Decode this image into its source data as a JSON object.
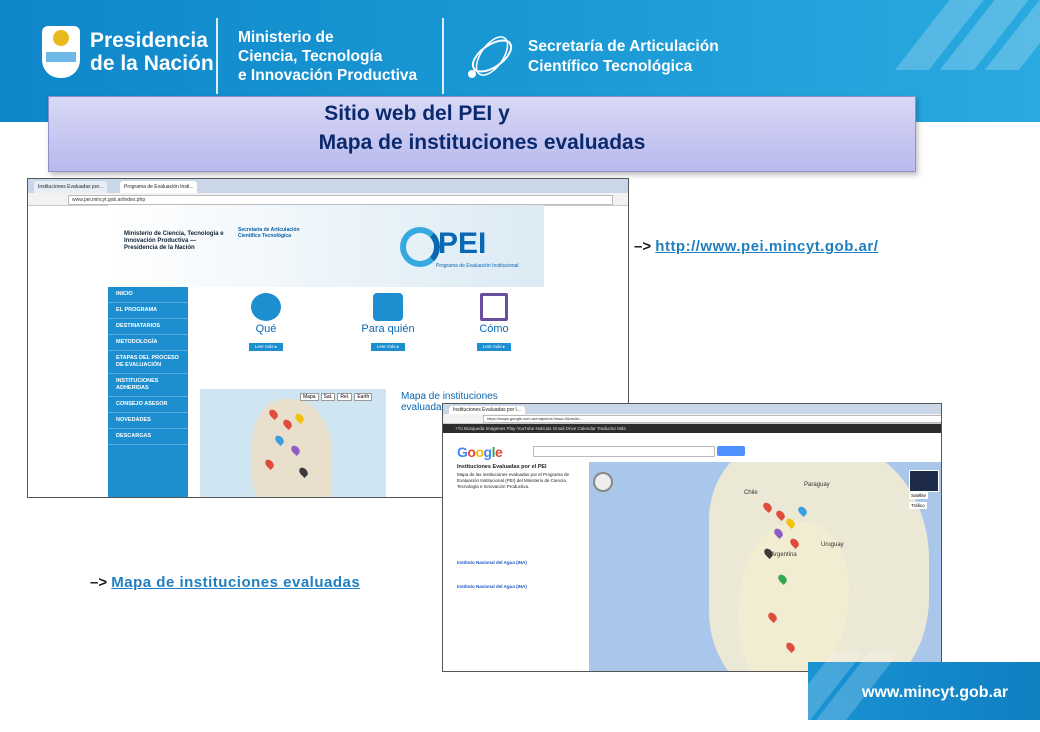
{
  "header": {
    "presidencia": [
      "Presidencia",
      "de la Nación"
    ],
    "ministerio": [
      "Ministerio de",
      "Ciencia, Tecnología",
      "e Innovación Productiva"
    ],
    "secretaria": [
      "Secretaría de Articulación",
      "Científico Tecnológica"
    ]
  },
  "title": {
    "line1": "Sitio web del PEI y",
    "line2": "Mapa de instituciones evaluadas"
  },
  "links": {
    "pei_arrow": "–>",
    "pei_url": "http://www.pei.mincyt.gob.ar/",
    "map_arrow": "–>",
    "map_label": "Mapa de instituciones evaluadas"
  },
  "screenshot1": {
    "tabs": [
      "Instituciones Evaluadas por...",
      "Programa de Evaluación Insti..."
    ],
    "url": "www.pei.mincyt.gob.ar/index.php",
    "brand_text": "PEI",
    "brand_sub": "Programa de Evaluación Institucional",
    "mini_brand": "Ministerio de Ciencia, Tecnología e Innovación Productiva — Presidencia de la Nación",
    "mini_secretaria": "Secretaría de Articulación Científico Tecnológica",
    "nav": [
      "INICIO",
      "EL PROGRAMA",
      "DESTINATARIOS",
      "METODOLOGÍA",
      "ETAPAS DEL PROCESO DE EVALUACIÓN",
      "INSTITUCIONES ADHERIDAS",
      "CONSEJO ASESOR",
      "NOVEDADES",
      "DESCARGAS"
    ],
    "col_que": "Qué",
    "col_para": "Para quién",
    "col_como": "Cómo",
    "leer_mas": "Leer más ▸",
    "map_heading": "Mapa de instituciones evaluadas",
    "map_tabs": [
      "Mapa",
      "Sat.",
      "Rel.",
      "Earth"
    ]
  },
  "screenshot2": {
    "tab": "Instituciones Evaluadas por l...",
    "url": "https://maps.google.com.ar/maps/ms?msa=0&msid=...",
    "gbar": "+Tú   Búsqueda   Imágenes   Play   YouTube   Noticias   Gmail   Drive   Calendar   Traductor   Más",
    "logo": "Google",
    "side_title": "Instituciones Evaluadas por el PEI",
    "side_text": "Mapa de las instituciones evaluadas por el Programa de Evaluación Institucional (PEI) del Ministerio de Ciencia, Tecnología e Innovación Productiva.",
    "item1": "Instituto Nacional del Agua (INA)",
    "item2": "Instituto Nacional del Agua (INA)",
    "countries": [
      "Chile",
      "Paraguay",
      "Argentina",
      "Uruguay"
    ],
    "layer_buttons": [
      "Satélite",
      "Tráfico"
    ]
  },
  "footer": {
    "site": "www.mincyt.gob.ar"
  }
}
